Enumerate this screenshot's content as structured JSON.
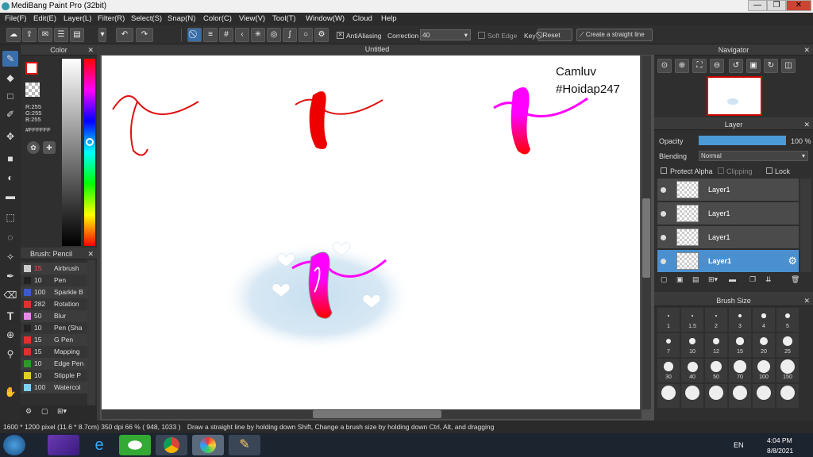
{
  "window": {
    "title": "MediBang Paint Pro (32bit)",
    "controls": [
      "—",
      "❐",
      "✕"
    ]
  },
  "menu": [
    "File(F)",
    "Edit(E)",
    "Layer(L)",
    "Filter(R)",
    "Select(S)",
    "Snap(N)",
    "Color(C)",
    "View(V)",
    "Tool(T)",
    "Window(W)",
    "Cloud",
    "Help"
  ],
  "toolbar": {
    "antialiasing": "AntiAliasing",
    "correction_label": "Correction",
    "correction_value": "40",
    "soft_edge": "Soft Edge",
    "key": "Key",
    "reset": "Reset",
    "straight_line": "Create a straight line"
  },
  "color_panel": {
    "title": "Color",
    "r": "R:255",
    "g": "G:255",
    "b": "B:255",
    "hex": "#FFFFFF"
  },
  "brush_panel": {
    "title": "Brush: Pencil",
    "items": [
      {
        "size": "15",
        "name": "Airbrush",
        "color": "#cccccc"
      },
      {
        "size": "10",
        "name": "Pen",
        "color": "#222222"
      },
      {
        "size": "100",
        "name": "Sparkle B",
        "color": "#3a5ad0"
      },
      {
        "size": "282",
        "name": "Rotation",
        "color": "#e03030"
      },
      {
        "size": "50",
        "name": "Blur",
        "color": "#e88ae8"
      },
      {
        "size": "10",
        "name": "Pen (Sha",
        "color": "#222222"
      },
      {
        "size": "15",
        "name": "G Pen",
        "color": "#e03030"
      },
      {
        "size": "15",
        "name": "Mapping",
        "color": "#e03030"
      },
      {
        "size": "10",
        "name": "Edge Pen",
        "color": "#2a9a2a"
      },
      {
        "size": "10",
        "name": "Stipple P",
        "color": "#e0d020"
      },
      {
        "size": "100",
        "name": "Watercol",
        "color": "#80d0f0"
      }
    ]
  },
  "canvas": {
    "tab": "Untitled",
    "watermark_line1": "Camluv",
    "watermark_line2": "#Hoidap247"
  },
  "navigator": {
    "title": "Navigator"
  },
  "layer_panel": {
    "title": "Layer",
    "opacity_label": "Opacity",
    "opacity_value": "100 %",
    "opacity_fraction": 1.0,
    "blending_label": "Blending",
    "blending_value": "Normal",
    "protect_alpha": "Protect Alpha",
    "clipping": "Clipping",
    "lock": "Lock",
    "layers": [
      "Layer1",
      "Layer1",
      "Layer1",
      "Layer1"
    ]
  },
  "brush_size": {
    "title": "Brush Size",
    "sizes": [
      "1",
      "1.5",
      "2",
      "3",
      "4",
      "5",
      "7",
      "10",
      "12",
      "15",
      "20",
      "25",
      "30",
      "40",
      "50",
      "70",
      "100",
      "150"
    ]
  },
  "status": {
    "dims": "1600 * 1200 pixel",
    "cm": "(11.6 * 8.7cm)",
    "dpi": "350 dpi",
    "zoom": "66 %",
    "coords": "( 948, 1033 )",
    "hint": "Draw a straight line by holding down Shift, Change a brush size by holding down Ctrl, Alt, and dragging"
  },
  "taskbar": {
    "lang": "EN",
    "time": "4:04 PM",
    "date": "8/8/2021"
  },
  "colors": {
    "accent": "#4a90d0",
    "red": "#e01010",
    "magenta": "#ff00ff"
  }
}
